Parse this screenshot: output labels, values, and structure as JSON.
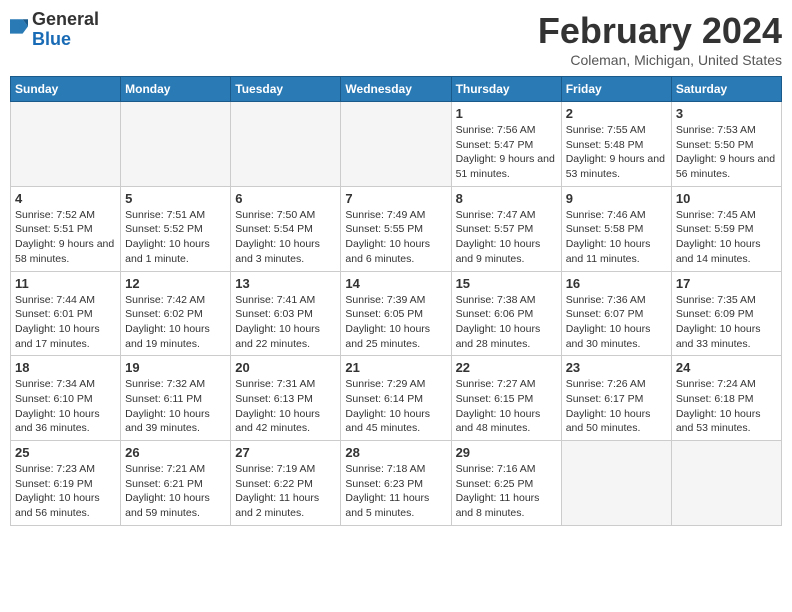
{
  "header": {
    "logo": {
      "general": "General",
      "blue": "Blue"
    },
    "title": "February 2024",
    "location": "Coleman, Michigan, United States"
  },
  "calendar": {
    "days_of_week": [
      "Sunday",
      "Monday",
      "Tuesday",
      "Wednesday",
      "Thursday",
      "Friday",
      "Saturday"
    ],
    "weeks": [
      [
        {
          "day": "",
          "info": ""
        },
        {
          "day": "",
          "info": ""
        },
        {
          "day": "",
          "info": ""
        },
        {
          "day": "",
          "info": ""
        },
        {
          "day": "1",
          "info": "Sunrise: 7:56 AM\nSunset: 5:47 PM\nDaylight: 9 hours and 51 minutes."
        },
        {
          "day": "2",
          "info": "Sunrise: 7:55 AM\nSunset: 5:48 PM\nDaylight: 9 hours and 53 minutes."
        },
        {
          "day": "3",
          "info": "Sunrise: 7:53 AM\nSunset: 5:50 PM\nDaylight: 9 hours and 56 minutes."
        }
      ],
      [
        {
          "day": "4",
          "info": "Sunrise: 7:52 AM\nSunset: 5:51 PM\nDaylight: 9 hours and 58 minutes."
        },
        {
          "day": "5",
          "info": "Sunrise: 7:51 AM\nSunset: 5:52 PM\nDaylight: 10 hours and 1 minute."
        },
        {
          "day": "6",
          "info": "Sunrise: 7:50 AM\nSunset: 5:54 PM\nDaylight: 10 hours and 3 minutes."
        },
        {
          "day": "7",
          "info": "Sunrise: 7:49 AM\nSunset: 5:55 PM\nDaylight: 10 hours and 6 minutes."
        },
        {
          "day": "8",
          "info": "Sunrise: 7:47 AM\nSunset: 5:57 PM\nDaylight: 10 hours and 9 minutes."
        },
        {
          "day": "9",
          "info": "Sunrise: 7:46 AM\nSunset: 5:58 PM\nDaylight: 10 hours and 11 minutes."
        },
        {
          "day": "10",
          "info": "Sunrise: 7:45 AM\nSunset: 5:59 PM\nDaylight: 10 hours and 14 minutes."
        }
      ],
      [
        {
          "day": "11",
          "info": "Sunrise: 7:44 AM\nSunset: 6:01 PM\nDaylight: 10 hours and 17 minutes."
        },
        {
          "day": "12",
          "info": "Sunrise: 7:42 AM\nSunset: 6:02 PM\nDaylight: 10 hours and 19 minutes."
        },
        {
          "day": "13",
          "info": "Sunrise: 7:41 AM\nSunset: 6:03 PM\nDaylight: 10 hours and 22 minutes."
        },
        {
          "day": "14",
          "info": "Sunrise: 7:39 AM\nSunset: 6:05 PM\nDaylight: 10 hours and 25 minutes."
        },
        {
          "day": "15",
          "info": "Sunrise: 7:38 AM\nSunset: 6:06 PM\nDaylight: 10 hours and 28 minutes."
        },
        {
          "day": "16",
          "info": "Sunrise: 7:36 AM\nSunset: 6:07 PM\nDaylight: 10 hours and 30 minutes."
        },
        {
          "day": "17",
          "info": "Sunrise: 7:35 AM\nSunset: 6:09 PM\nDaylight: 10 hours and 33 minutes."
        }
      ],
      [
        {
          "day": "18",
          "info": "Sunrise: 7:34 AM\nSunset: 6:10 PM\nDaylight: 10 hours and 36 minutes."
        },
        {
          "day": "19",
          "info": "Sunrise: 7:32 AM\nSunset: 6:11 PM\nDaylight: 10 hours and 39 minutes."
        },
        {
          "day": "20",
          "info": "Sunrise: 7:31 AM\nSunset: 6:13 PM\nDaylight: 10 hours and 42 minutes."
        },
        {
          "day": "21",
          "info": "Sunrise: 7:29 AM\nSunset: 6:14 PM\nDaylight: 10 hours and 45 minutes."
        },
        {
          "day": "22",
          "info": "Sunrise: 7:27 AM\nSunset: 6:15 PM\nDaylight: 10 hours and 48 minutes."
        },
        {
          "day": "23",
          "info": "Sunrise: 7:26 AM\nSunset: 6:17 PM\nDaylight: 10 hours and 50 minutes."
        },
        {
          "day": "24",
          "info": "Sunrise: 7:24 AM\nSunset: 6:18 PM\nDaylight: 10 hours and 53 minutes."
        }
      ],
      [
        {
          "day": "25",
          "info": "Sunrise: 7:23 AM\nSunset: 6:19 PM\nDaylight: 10 hours and 56 minutes."
        },
        {
          "day": "26",
          "info": "Sunrise: 7:21 AM\nSunset: 6:21 PM\nDaylight: 10 hours and 59 minutes."
        },
        {
          "day": "27",
          "info": "Sunrise: 7:19 AM\nSunset: 6:22 PM\nDaylight: 11 hours and 2 minutes."
        },
        {
          "day": "28",
          "info": "Sunrise: 7:18 AM\nSunset: 6:23 PM\nDaylight: 11 hours and 5 minutes."
        },
        {
          "day": "29",
          "info": "Sunrise: 7:16 AM\nSunset: 6:25 PM\nDaylight: 11 hours and 8 minutes."
        },
        {
          "day": "",
          "info": ""
        },
        {
          "day": "",
          "info": ""
        }
      ]
    ]
  }
}
